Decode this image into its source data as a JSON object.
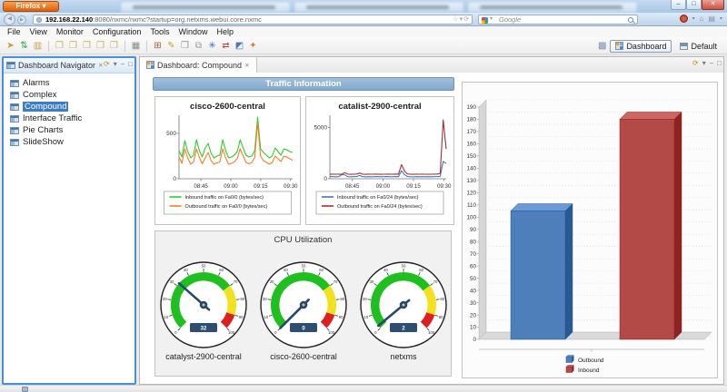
{
  "browser": {
    "firefox_button": "Firefox",
    "url": {
      "host": "192.168.22.140",
      "rest": ":8080/nxmc/nxmc?startup=org.netxms.webui.core.nxmc"
    },
    "search": {
      "engine": "Google"
    },
    "icons": {
      "back": "◀",
      "forward": "▶",
      "star": "☆",
      "caret": "▾",
      "refresh": "⟳",
      "home": "⌂",
      "bookmarks": "▤",
      "minimize": "–",
      "maximize": "□",
      "close": "✕",
      "view_refresh": "⟳",
      "menu_down": "▾",
      "view_min": "–",
      "view_max": "□"
    }
  },
  "menu_bar": {
    "items": [
      "File",
      "View",
      "Monitor",
      "Configuration",
      "Tools",
      "Window",
      "Help"
    ]
  },
  "toolbar": {
    "icons": [
      {
        "name": "select-pointer-icon",
        "glyph": "➤",
        "color": "#d49a2a"
      },
      {
        "name": "sort-updown-icon",
        "glyph": "⇅",
        "color": "#3aa53a"
      },
      {
        "name": "open-folder-icon",
        "glyph": "▥",
        "color": "#c9a34a"
      },
      {
        "sep": true
      },
      {
        "name": "report-icon-1",
        "glyph": "❒",
        "color": "#d0b050"
      },
      {
        "name": "report-icon-2",
        "glyph": "❒",
        "color": "#d0b050"
      },
      {
        "name": "report-icon-3",
        "glyph": "❒",
        "color": "#d0b050"
      },
      {
        "name": "report-icon-4",
        "glyph": "❒",
        "color": "#d0b050"
      },
      {
        "name": "report-icon-5",
        "glyph": "❒",
        "color": "#d0b050"
      },
      {
        "sep": true
      },
      {
        "name": "object-browser-icon",
        "glyph": "▦",
        "color": "#8a8a8a"
      },
      {
        "sep": true
      },
      {
        "name": "table-grid-icon",
        "glyph": "⊞",
        "color": "#b06030"
      },
      {
        "name": "edit-icon",
        "glyph": "✎",
        "color": "#caa020"
      },
      {
        "name": "document-icon",
        "glyph": "❐",
        "color": "#909090"
      },
      {
        "name": "copy-icon",
        "glyph": "⧉",
        "color": "#9a9a9a"
      },
      {
        "name": "new-object-icon",
        "glyph": "✳",
        "color": "#3a6ad0"
      },
      {
        "name": "relations-icon",
        "glyph": "⇄",
        "color": "#c04040"
      },
      {
        "name": "chart-edit-icon",
        "glyph": "◩",
        "color": "#4a7ab0"
      },
      {
        "name": "tools-icon",
        "glyph": "✦",
        "color": "#d08030"
      }
    ],
    "perspectives": [
      {
        "label": "Dashboard",
        "active": true
      },
      {
        "label": "Default",
        "active": false
      }
    ]
  },
  "sidebar": {
    "title": "Dashboard Navigator",
    "selected": "Compound",
    "items": [
      "Alarms",
      "Complex",
      "Compound",
      "Interface Traffic",
      "Pie Charts",
      "SlideShow"
    ]
  },
  "editor": {
    "tab_label": "Dashboard: Compound"
  },
  "dashboard": {
    "traffic_header": "Traffic Information",
    "cpu_header": "CPU Utilization"
  },
  "chart_data": [
    {
      "type": "line",
      "title": "cisco-2600-central",
      "x_ticks": [
        "08:45",
        "09:00",
        "09:15",
        "09:30"
      ],
      "ylim": [
        0,
        700
      ],
      "y_ticks": [
        500,
        0
      ],
      "grid": false,
      "legend_position": "bottom",
      "series": [
        {
          "name": "Inbound traffic on Fa0/0 (bytes/sec)",
          "color": "#2ecc2e",
          "values": [
            310,
            240,
            420,
            300,
            230,
            260,
            430,
            310,
            240,
            340,
            390,
            280,
            230,
            250,
            260,
            430,
            310,
            230,
            240,
            260,
            300,
            430,
            340,
            260,
            240,
            250,
            310,
            680,
            330,
            290,
            260,
            230,
            250,
            340,
            300,
            260,
            330,
            320,
            300,
            290
          ]
        },
        {
          "name": "Outbound traffic on Fa0/0 (bytes/sec)",
          "color": "#fa7d29",
          "values": [
            240,
            170,
            330,
            230,
            160,
            185,
            330,
            235,
            165,
            230,
            290,
            200,
            160,
            175,
            185,
            330,
            230,
            160,
            170,
            185,
            225,
            330,
            255,
            180,
            165,
            180,
            235,
            615,
            250,
            200,
            180,
            160,
            180,
            250,
            220,
            190,
            250,
            240,
            220,
            205
          ]
        }
      ]
    },
    {
      "type": "line",
      "title": "catalist-2900-central",
      "x_ticks": [
        "08:45",
        "09:00",
        "09:15",
        "09:30"
      ],
      "ylim": [
        0,
        6200
      ],
      "y_ticks": [
        5000,
        0
      ],
      "grid": false,
      "legend_position": "bottom",
      "series": [
        {
          "name": "Inbound traffic on Fa0/24 (bytes/sec)",
          "color": "#4a77ad",
          "values": [
            200,
            210,
            190,
            215,
            400,
            380,
            200,
            195,
            205,
            215,
            340,
            205,
            190,
            205,
            195,
            205,
            210,
            195,
            200,
            210,
            205,
            195,
            210,
            200,
            790,
            420,
            215,
            195,
            190,
            200,
            195,
            205,
            195,
            200,
            195,
            205,
            210,
            240,
            1700,
            1480
          ]
        },
        {
          "name": "Outbound traffic on Fa0/24 (bytes/sec)",
          "color": "#a13232",
          "values": [
            430,
            450,
            440,
            455,
            445,
            590,
            450,
            435,
            445,
            460,
            555,
            445,
            430,
            450,
            440,
            455,
            450,
            430,
            445,
            450,
            455,
            445,
            460,
            450,
            1380,
            760,
            470,
            445,
            435,
            450,
            440,
            450,
            445,
            430,
            445,
            450,
            460,
            520,
            5750,
            2900
          ]
        }
      ]
    },
    {
      "type": "gauge",
      "title": "CPU Utilization",
      "min": 0,
      "max": 100,
      "zones": [
        {
          "from": 0,
          "to": 70,
          "color": "#1fbf1f"
        },
        {
          "from": 70,
          "to": 90,
          "color": "#f2e11f"
        },
        {
          "from": 90,
          "to": 100,
          "color": "#dd1f1f"
        }
      ],
      "needle_color": "#25486b",
      "gauges": [
        {
          "label": "catalyst-2900-central",
          "value": 32
        },
        {
          "label": "cisco-2600-central",
          "value": 0
        },
        {
          "label": "netxms",
          "value": 2
        }
      ]
    },
    {
      "type": "bar",
      "categories": [
        "Outbound",
        "Inbound"
      ],
      "values": [
        105,
        180
      ],
      "colors": [
        "#4f7fba",
        "#b34a47"
      ],
      "ylim": [
        0,
        190
      ],
      "tick_step": 10,
      "grid": true,
      "legend_position": "bottom"
    }
  ]
}
